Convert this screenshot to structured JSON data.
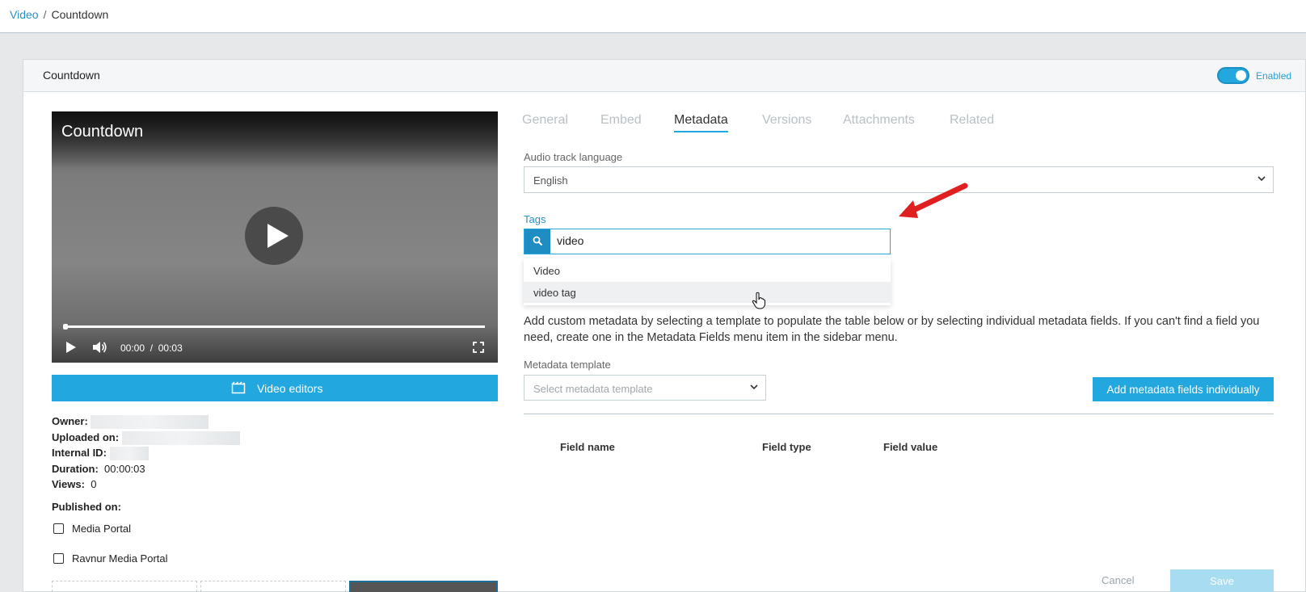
{
  "breadcrumb": {
    "parent": "Video",
    "separator": "/",
    "current": "Countdown"
  },
  "panel": {
    "title": "Countdown",
    "toggle_label": "Enabled",
    "enabled": true
  },
  "player": {
    "title": "Countdown",
    "current_time": "00:00",
    "time_sep": "/",
    "duration_time": "00:03",
    "progress": 0
  },
  "video_editors_label": "Video editors",
  "info": {
    "owner_label": "Owner:",
    "uploaded_label": "Uploaded on:",
    "internal_id_label": "Internal ID:",
    "duration_label": "Duration:",
    "duration_value": "00:00:03",
    "views_label": "Views:",
    "views_value": "0"
  },
  "published": {
    "label": "Published on:",
    "portals": [
      {
        "label": "Media Portal",
        "checked": false
      },
      {
        "label": "Ravnur Media Portal",
        "checked": false
      }
    ]
  },
  "tabs": [
    "General",
    "Embed",
    "Metadata",
    "Versions",
    "Attachments",
    "Related"
  ],
  "active_tab": "Metadata",
  "audio": {
    "label": "Audio track language",
    "value": "English"
  },
  "tags": {
    "label": "Tags",
    "input_value": "video",
    "suggestions": [
      "Video",
      "video tag"
    ]
  },
  "info_text": "Add custom metadata by selecting a template to populate the table below or by selecting individual metadata fields. If you can't find a field you need, create one in the Metadata Fields menu item in the sidebar menu.",
  "template": {
    "label": "Metadata template",
    "placeholder": "Select metadata template"
  },
  "add_fields_label": "Add metadata fields individually",
  "table": {
    "headers": [
      "Field name",
      "Field type",
      "Field value"
    ]
  },
  "footer": {
    "cancel_label": "Cancel",
    "save_label": "Save"
  },
  "colors": {
    "accent": "#22a7de",
    "link": "#2a8fc6",
    "annotation_arrow": "#e02020"
  },
  "icons": [
    "search-icon",
    "film-icon",
    "chevron-down-icon",
    "volume-icon",
    "fullscreen-icon",
    "play-icon"
  ]
}
